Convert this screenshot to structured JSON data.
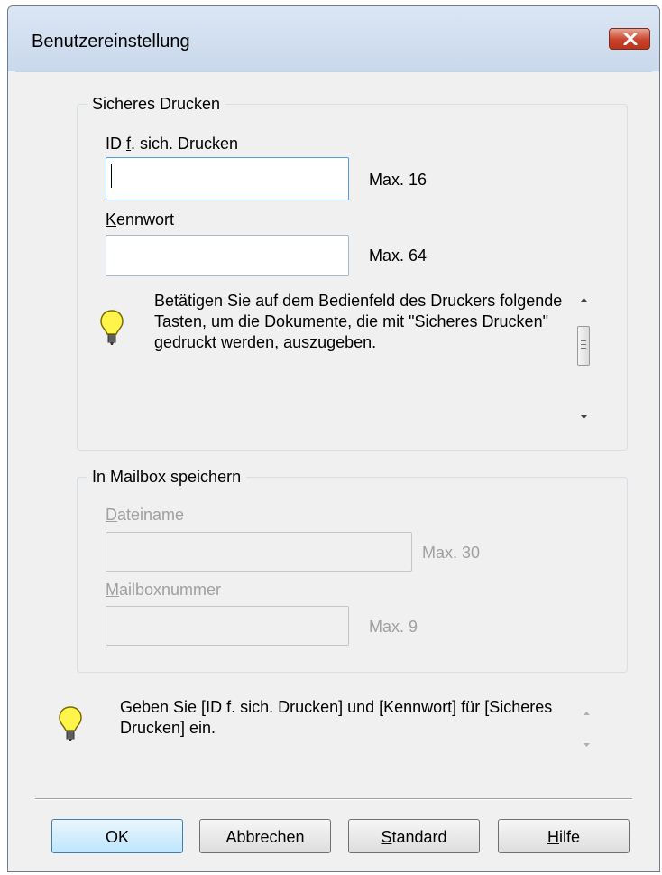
{
  "window": {
    "title": "Benutzereinstellung"
  },
  "secure_print": {
    "legend": "Sicheres Drucken",
    "id_label_pre": "ID ",
    "id_label_mnemonic": "f",
    "id_label_post": ". sich. Drucken",
    "id_value": "",
    "id_max": "Max. 16",
    "password_label_mnemonic": "K",
    "password_label_post": "ennwort",
    "password_value": "",
    "password_max": "Max. 64",
    "info_text": "Betätigen Sie auf dem Bedienfeld des Druckers folgende Tasten, um die Dokumente, die mit \"Sicheres Drucken\" gedruckt werden, auszugeben."
  },
  "mailbox": {
    "legend": "In Mailbox speichern",
    "filename_label_mnemonic": "D",
    "filename_label_post": "ateiname",
    "filename_value": "",
    "filename_max": "Max. 30",
    "number_label_mnemonic": "M",
    "number_label_post": "ailboxnummer",
    "number_value": "",
    "number_max": "Max. 9"
  },
  "hint": {
    "text": "Geben Sie [ID f. sich. Drucken] und [Kennwort] für [Sicheres Drucken] ein."
  },
  "buttons": {
    "ok": "OK",
    "cancel": "Abbrechen",
    "standard_mnemonic": "S",
    "standard_post": "tandard",
    "help_mnemonic": "H",
    "help_post": "ilfe"
  },
  "icons": {
    "close": "close-icon",
    "bulb": "lightbulb-icon"
  }
}
